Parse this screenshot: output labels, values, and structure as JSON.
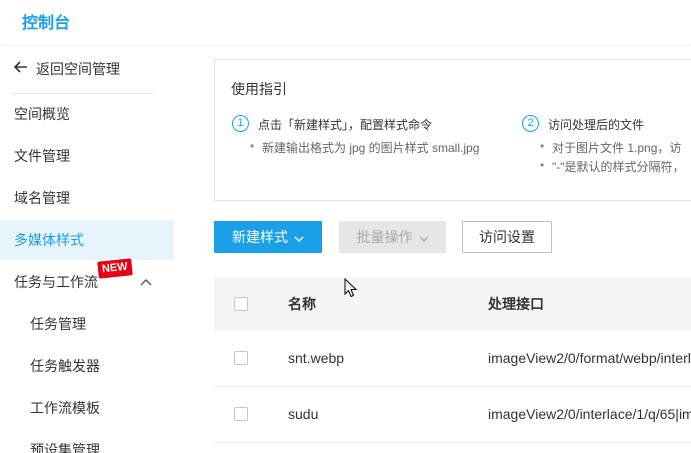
{
  "header": {
    "title": "控制台"
  },
  "sidebar": {
    "back_label": "返回空间管理",
    "items": [
      {
        "label": "空间概览"
      },
      {
        "label": "文件管理"
      },
      {
        "label": "域名管理"
      },
      {
        "label": "多媒体样式"
      },
      {
        "label": "任务与工作流"
      },
      {
        "label": "任务管理"
      },
      {
        "label": "任务触发器"
      },
      {
        "label": "工作流模板"
      },
      {
        "label": "预设集管理"
      }
    ],
    "new_badge": "NEW"
  },
  "guide": {
    "title": "使用指引",
    "step1": {
      "num": "1",
      "title": "点击「新建样式」，配置样式命令",
      "bullet1": "新建输出格式为 jpg 的图片样式 small.jpg"
    },
    "step2": {
      "num": "2",
      "title": "访问处理后的文件",
      "bullet1": "对于图片文件 1.png，访",
      "bullet2": "\"-\"是默认的样式分隔符，"
    }
  },
  "toolbar": {
    "new_style": "新建样式",
    "batch": "批量操作",
    "access": "访问设置"
  },
  "table": {
    "headers": {
      "name": "名称",
      "proc": "处理接口"
    },
    "rows": [
      {
        "name": "snt.webp",
        "proc": "imageView2/0/format/webp/interl"
      },
      {
        "name": "sudu",
        "proc": "imageView2/0/interlace/1/q/65|im"
      }
    ]
  },
  "colors": {
    "accent": "#1aa0e6",
    "badge": "#e60012"
  }
}
